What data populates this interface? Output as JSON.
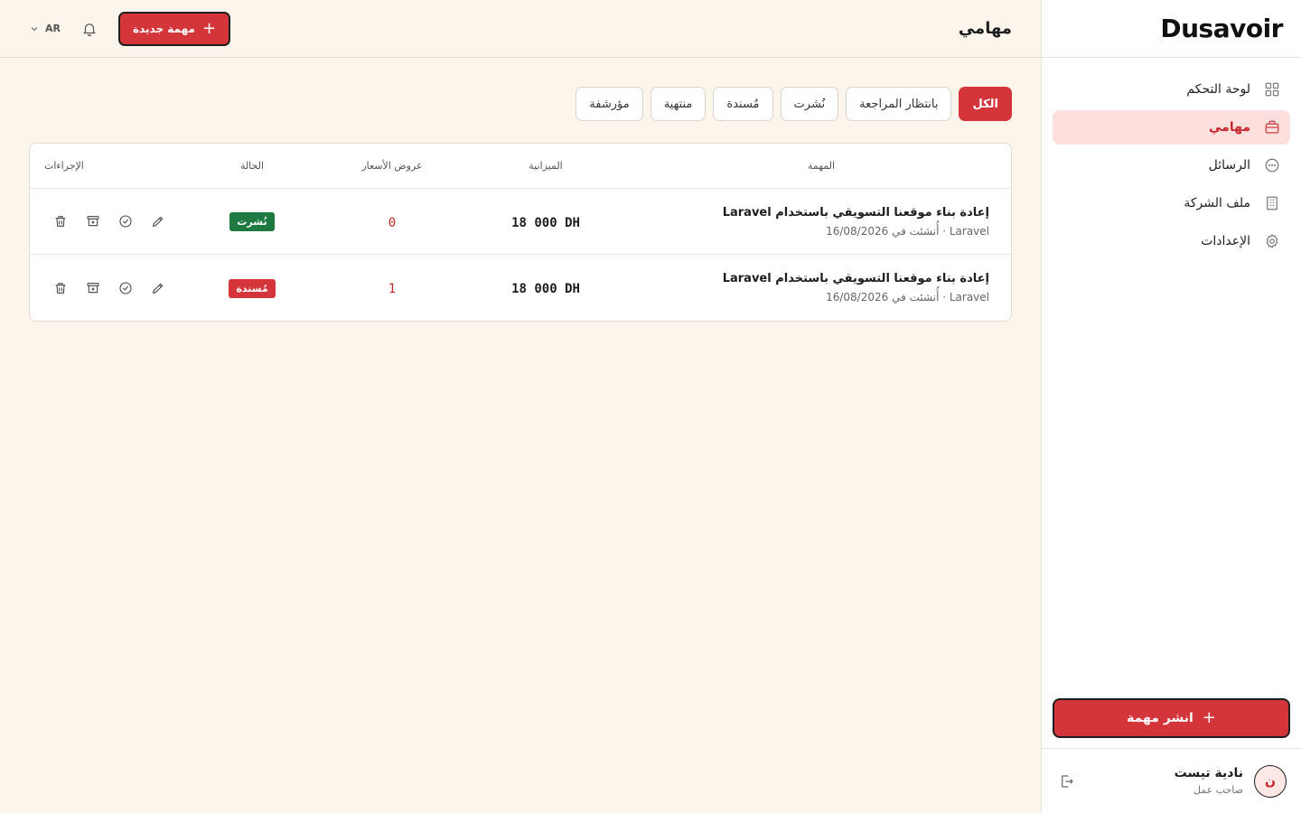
{
  "app": {
    "logo": "Dusavoir",
    "page_title": "مهامي"
  },
  "header": {
    "new_task_label": "مهمة جديدة",
    "lang": "AR"
  },
  "sidebar": {
    "items": [
      {
        "label": "لوحة التحكم",
        "icon": "grid-icon"
      },
      {
        "label": "مهامي",
        "icon": "briefcase-icon",
        "active": true
      },
      {
        "label": "الرسائل",
        "icon": "chat-icon"
      },
      {
        "label": "ملف الشركة",
        "icon": "building-icon"
      },
      {
        "label": "الإعدادات",
        "icon": "gear-icon"
      }
    ],
    "publish_label": "انشر مهمة",
    "user": {
      "initial": "ن",
      "name": "نادية تيست",
      "role": "صاحب عمل"
    }
  },
  "filters": [
    "الكل",
    "بانتظار المراجعة",
    "نُشرت",
    "مُسندة",
    "منتهية",
    "مؤرشفة"
  ],
  "table": {
    "headers": {
      "task": "المهمة",
      "budget": "الميزانية",
      "bids": "عروض الأسعار",
      "status": "الحالة",
      "actions": "الإجراءات"
    },
    "rows": [
      {
        "title": "إعادة بناء موقعنا التسويقي باستخدام Laravel",
        "meta": "Laravel · أُنشئت في 16/08/2026",
        "budget": "18 000 DH",
        "bids": "0",
        "status": "نُشرت",
        "status_color": "#1e7a41"
      },
      {
        "title": "إعادة بناء موقعنا التسويقي باستخدام Laravel",
        "meta": "Laravel · أُنشئت في 16/08/2026",
        "budget": "18 000 DH",
        "bids": "1",
        "status": "مُسندة",
        "status_color": "#d4353a"
      }
    ]
  },
  "colors": {
    "accent": "#d4353a",
    "success": "#1e7a41",
    "background": "#fcf5ec"
  }
}
